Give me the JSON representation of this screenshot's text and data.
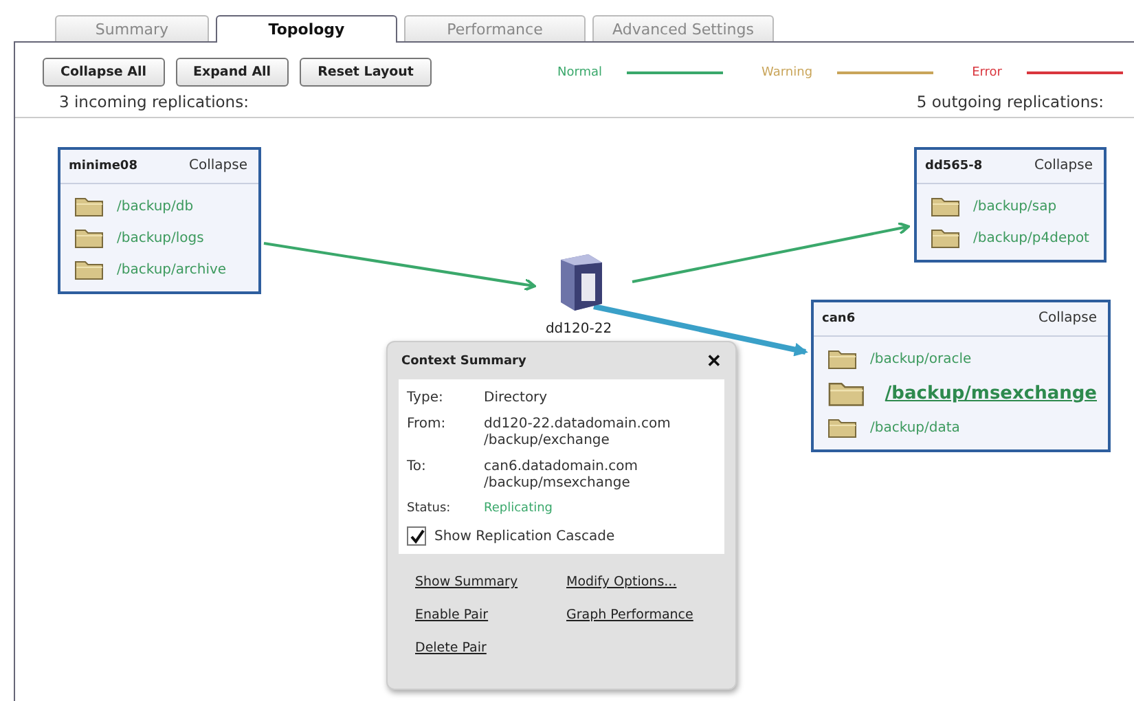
{
  "tabs": [
    {
      "label": "Summary",
      "selected": false
    },
    {
      "label": "Topology",
      "selected": true
    },
    {
      "label": "Performance",
      "selected": false
    },
    {
      "label": "Advanced Settings",
      "selected": false
    }
  ],
  "toolbar": {
    "buttons": [
      "Collapse All",
      "Expand All",
      "Reset Layout"
    ]
  },
  "legend": [
    {
      "label": "Normal",
      "color": "#3aa86b"
    },
    {
      "label": "Warning",
      "color": "#c9a55a"
    },
    {
      "label": "Error",
      "color": "#d9363e"
    }
  ],
  "incoming_count": "3 incoming replications:",
  "outgoing_count": "5 outgoing replications:",
  "nodes": [
    {
      "name": "minime08",
      "action": "Collapse",
      "folders": [
        {
          "path": "/backup/db",
          "selected": false
        },
        {
          "path": "/backup/logs",
          "selected": false
        },
        {
          "path": "/backup/archive",
          "selected": false
        }
      ]
    },
    {
      "name": "dd565-8",
      "action": "Collapse",
      "folders": [
        {
          "path": "/backup/sap",
          "selected": false
        },
        {
          "path": "/backup/p4depot",
          "selected": false
        }
      ]
    },
    {
      "name": "can6",
      "action": "Collapse",
      "folders": [
        {
          "path": "/backup/oracle",
          "selected": false
        },
        {
          "path": "/backup/msexchange",
          "selected": true
        },
        {
          "path": "/backup/data",
          "selected": false
        }
      ]
    }
  ],
  "server": {
    "name": "dd120-22"
  },
  "edges": [
    {
      "color": "#3aa86b",
      "selected": false
    },
    {
      "color": "#3aa86b",
      "selected": false
    },
    {
      "color": "#3aa0c8",
      "selected": true
    }
  ],
  "context_summary": {
    "title": "Context Summary",
    "close": "✕",
    "fields": [
      {
        "label": "Type:",
        "lines": [
          "Directory"
        ]
      },
      {
        "label": "From:",
        "lines": [
          "dd120-22.datadomain.com",
          "/backup/exchange"
        ]
      },
      {
        "label": "To:",
        "lines": [
          "can6.datadomain.com",
          "/backup/msexchange"
        ]
      }
    ],
    "status": {
      "label": "Status:",
      "value": "Replicating"
    },
    "cascade": {
      "label": "Show Replication Cascade",
      "checked": true
    },
    "links": [
      "Show Summary",
      "Modify Options...",
      "Enable Pair",
      "Graph Performance",
      "Delete Pair"
    ]
  }
}
